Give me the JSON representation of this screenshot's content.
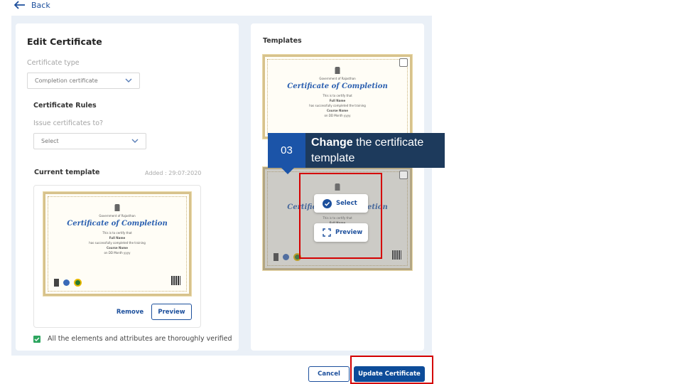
{
  "nav": {
    "back_label": "Back"
  },
  "edit": {
    "title": "Edit Certificate",
    "type_label": "Certificate type",
    "type_value": "Completion certificate",
    "rules_heading": "Certificate Rules",
    "issue_label": "Issue certificates to?",
    "issue_value": "Select",
    "current_heading": "Current template",
    "added_text": "Added : 29:07:2020",
    "remove_label": "Remove",
    "preview_label": "Preview",
    "verify_text": "All the elements and attributes are thoroughly verified"
  },
  "certificate": {
    "org": "Government of Rajasthan",
    "title": "Certificate of Completion",
    "certify": "This is to certify that",
    "name": "Full Name",
    "completed": "has successfully completed the training",
    "course": "Course Name",
    "date": "on DD Month yyyy"
  },
  "templates": {
    "heading": "Templates",
    "select_label": "Select",
    "preview_label": "Preview"
  },
  "callout": {
    "step": "03",
    "bold": "Change",
    "rest": " the certificate template"
  },
  "footer": {
    "cancel_label": "Cancel",
    "update_label": "Update Certificate"
  },
  "colors": {
    "primary": "#0d4c99",
    "accent_green": "#2da55f",
    "highlight_red": "#d40000",
    "callout_bg": "#1d3a5c"
  }
}
